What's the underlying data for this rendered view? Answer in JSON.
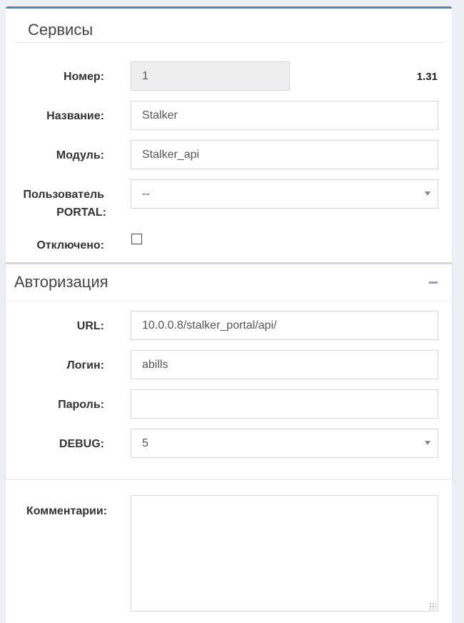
{
  "services": {
    "title": "Сервисы",
    "version": "1.31",
    "number": {
      "label": "Номер:",
      "value": "1"
    },
    "name": {
      "label": "Название:",
      "value": "Stalker"
    },
    "module": {
      "label": "Модуль:",
      "value": "Stalker_api"
    },
    "portal_user": {
      "label_line1": "Пользователь",
      "label_line2": "PORTAL:",
      "value": "--"
    },
    "disabled": {
      "label": "Отключено:",
      "checked": false
    }
  },
  "auth": {
    "title": "Авторизация",
    "url": {
      "label": "URL:",
      "value": "10.0.0.8/stalker_portal/api/"
    },
    "login": {
      "label": "Логин:",
      "value": "abills"
    },
    "password": {
      "label": "Пароль:",
      "value": ""
    },
    "debug": {
      "label": "DEBUG:",
      "value": "5"
    }
  },
  "comments": {
    "label": "Комментарии:",
    "value": ""
  }
}
